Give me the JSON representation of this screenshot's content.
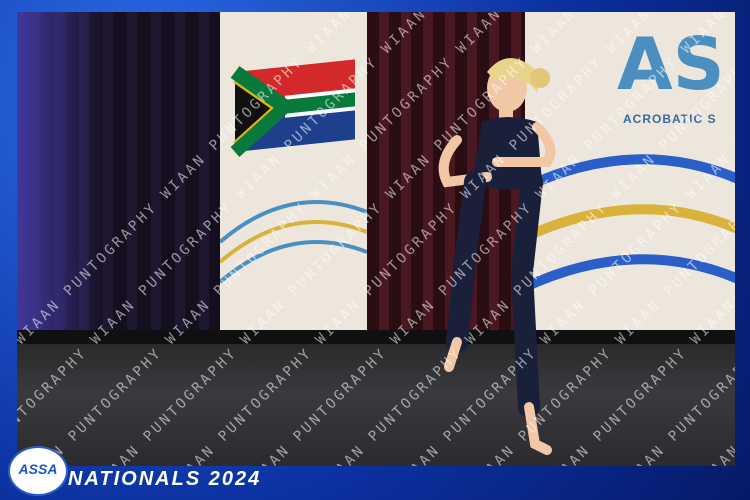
{
  "watermark": {
    "text": "WIAAN PUNTOGRAPHY"
  },
  "banner": {
    "logo_letters": "AS",
    "logo_subtitle": "ACROBATIC S"
  },
  "badge": {
    "label": "ASSA"
  },
  "event": {
    "title": "NATIONALS 2024"
  },
  "colors": {
    "frame": "#1a4fd0",
    "banner": "#ece6dc",
    "floor": "#333336",
    "accent": "#4a8fc0"
  }
}
